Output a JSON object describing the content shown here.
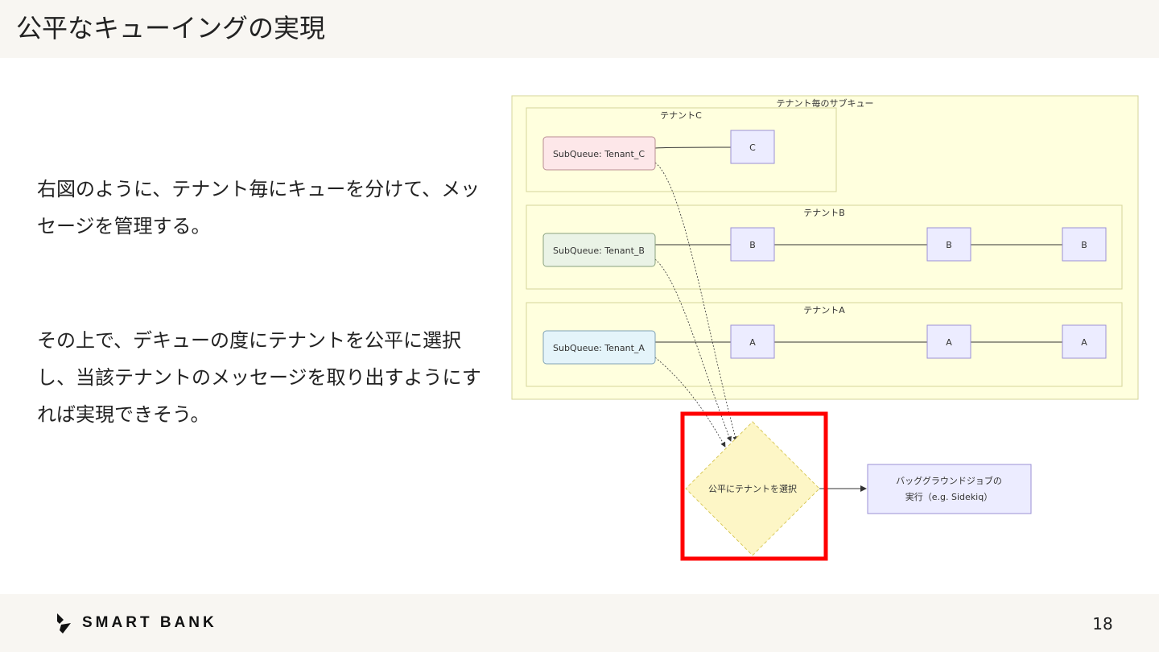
{
  "slide": {
    "title": "公平なキューイングの実現",
    "paragraph1": "右図のように、テナント毎にキューを分けて、メッセージを管理する。",
    "paragraph2": "その上で、デキューの度にテナントを公平に選択し、当該テナントのメッセージを取り出すようにすれば実現できそう。",
    "page_number": "18"
  },
  "footer": {
    "logo_text": "SMART BANK"
  },
  "diagram": {
    "outer_group_label": "テナント毎のサブキュー",
    "tenants": [
      {
        "label": "テナントC",
        "subqueue": "SubQueue: Tenant_C",
        "messages": [
          "C"
        ],
        "color": "#fde7e9"
      },
      {
        "label": "テナントB",
        "subqueue": "SubQueue: Tenant_B",
        "messages": [
          "B",
          "B",
          "B"
        ],
        "color": "#eaf3e6"
      },
      {
        "label": "テナントA",
        "subqueue": "SubQueue: Tenant_A",
        "messages": [
          "A",
          "A",
          "A"
        ],
        "color": "#e4f4fa"
      }
    ],
    "decision": "公平にテナントを選択",
    "job_line1": "バッググラウンドジョブの",
    "job_line2": "実行（e.g. Sidekiq）",
    "highlight_color": "#ff0000"
  }
}
